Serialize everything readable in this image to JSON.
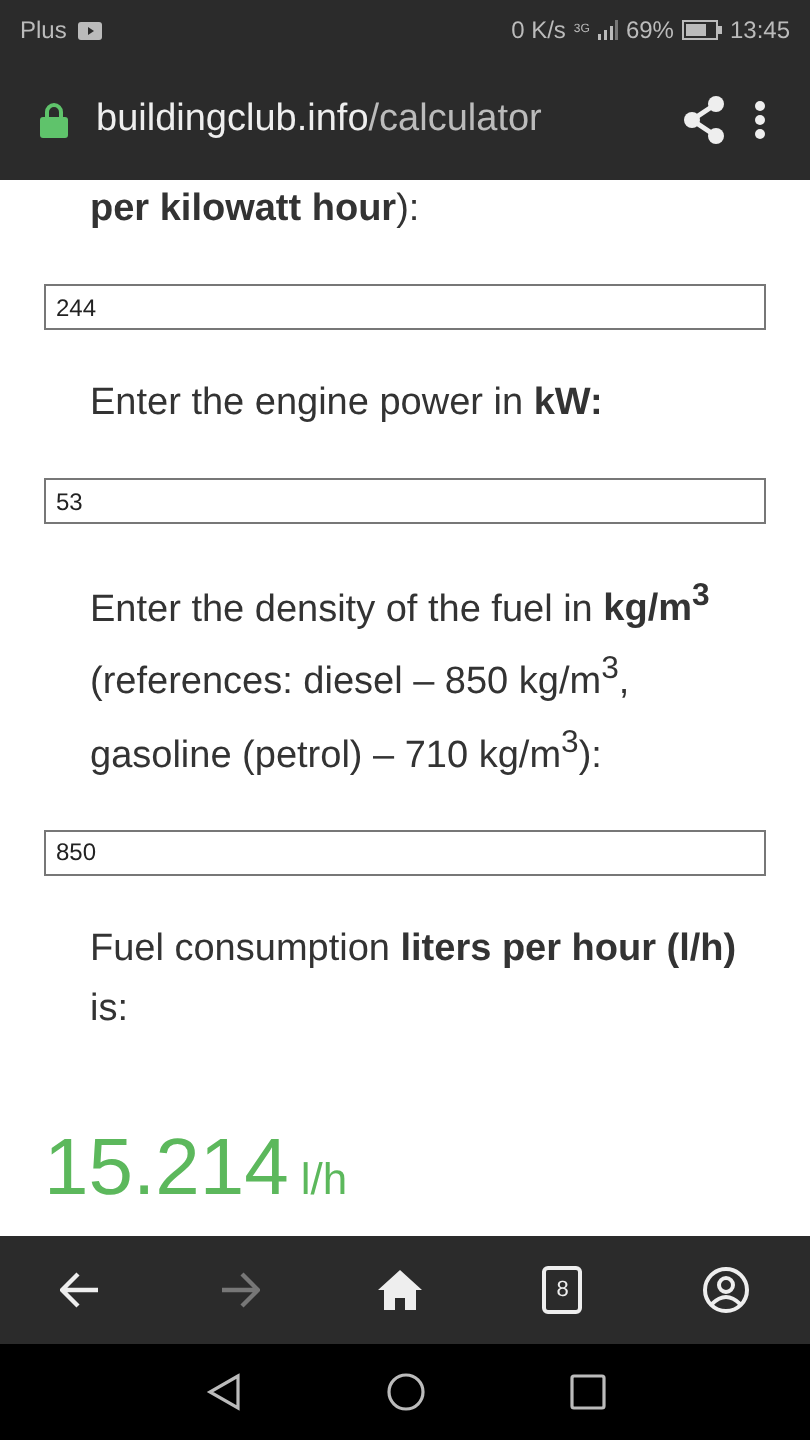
{
  "status_bar": {
    "carrier": "Plus",
    "speed": "0 K/s",
    "network": "3G",
    "battery_percent": "69%",
    "time": "13:45"
  },
  "address_bar": {
    "domain": "buildingclub.info",
    "path": "/calculator"
  },
  "form": [
    {
      "kind": "text",
      "text": "**per kilowatt hour**):"
    },
    {
      "kind": "input",
      "value": "244"
    },
    {
      "kind": "text",
      "text": "Enter the engine power in **kW:**"
    },
    {
      "kind": "input",
      "value": "53"
    },
    {
      "kind": "text",
      "text": "Enter the density of the fuel in **kg/m$^{3}$** (references: diesel – 850 kg/m$^{3}$, gasoline (petrol) – 710 kg/m$^{3}$):"
    },
    {
      "kind": "input",
      "value": "850"
    },
    {
      "kind": "text",
      "text": "Fuel consumption **liters per hour (l/h)** is:"
    }
  ],
  "result": {
    "value": "15.214",
    "unit": "l/h"
  },
  "browser_toolbar": {
    "tab_count": "8",
    "forward_disabled": true
  }
}
